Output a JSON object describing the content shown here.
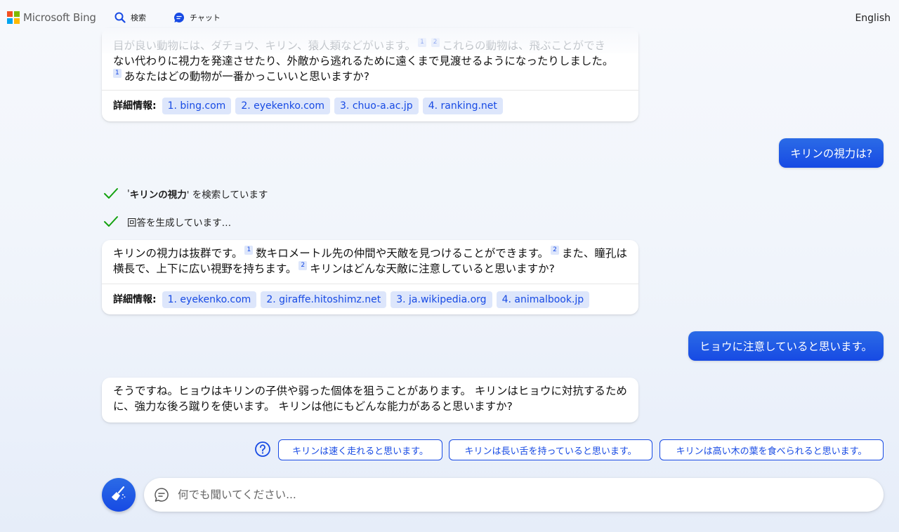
{
  "header": {
    "logo_text": "Microsoft Bing",
    "tabs": [
      {
        "label": "検索",
        "icon": "search-icon"
      },
      {
        "label": "チャット",
        "icon": "chat-icon"
      }
    ],
    "language": "English"
  },
  "colors": {
    "accent": "#174ae4",
    "chip_bg": "#dde6fb",
    "check": "#13a10e"
  },
  "messages": {
    "card1": {
      "line1": "目が良い動物には、ダチョウ、キリン、猿人類などがいます。",
      "cite1a": "1",
      "cite1b": "2",
      "line1b": "これらの動物は、飛ぶことができ",
      "line2": "ない代わりに視力を発達させたり、外敵から逃れるために遠くまで見渡せるようになったりしました。",
      "cite2": "1",
      "line3": "あなたはどの動物が一番かっこいいと思いますか?",
      "refs_label": "詳細情報:",
      "refs": [
        "1. bing.com",
        "2. eyekenko.com",
        "3. chuo-a.ac.jp",
        "4. ranking.net"
      ]
    },
    "user1": "キリンの視力は?",
    "progress": {
      "search_prefix": "'",
      "search_term": "キリンの視力",
      "search_suffix": "' を検索しています",
      "generating": "回答を生成しています…"
    },
    "card2": {
      "t1": "キリンの視力は抜群です。",
      "c1": "1",
      "t2": "数キロメートル先の仲間や天敵を見つけることができます。",
      "c2": "2",
      "t3": "また、瞳孔は横長で、上下に広い視野を持ちます。",
      "c3": "2",
      "t4": "キリンはどんな天敵に注意していると思いますか?",
      "refs_label": "詳細情報:",
      "refs": [
        "1. eyekenko.com",
        "2. giraffe.hitoshimz.net",
        "3. ja.wikipedia.org",
        "4. animalbook.jp"
      ]
    },
    "user2": "ヒョウに注意していると思います。",
    "card3": {
      "text": "そうですね。ヒョウはキリンの子供や弱った個体を狙うことがあります。 キリンはヒョウに対抗するために、強力な後ろ蹴りを使います。 キリンは他にもどんな能力があると思いますか?"
    }
  },
  "suggestions": [
    "キリンは速く走れると思います。",
    "キリンは長い舌を持っていると思います。",
    "キリンは高い木の葉を食べられると思います。"
  ],
  "input": {
    "placeholder": "何でも聞いてください..."
  }
}
